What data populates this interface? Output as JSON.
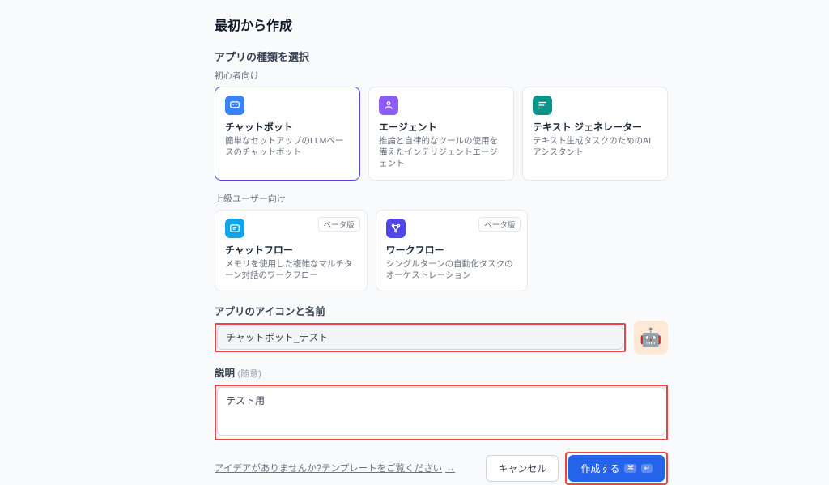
{
  "title": "最初から作成",
  "section_select_label": "アプリの種類を選択",
  "beginner_label": "初心者向け",
  "advanced_label": "上級ユーザー向け",
  "beta_label": "ベータ版",
  "cards": {
    "chatbot": {
      "title": "チャットボット",
      "desc": "簡単なセットアップのLLMベースのチャットボット"
    },
    "agent": {
      "title": "エージェント",
      "desc": "推論と自律的なツールの使用を備えたインテリジェントエージェント"
    },
    "textgen": {
      "title": "テキスト ジェネレーター",
      "desc": "テキスト生成タスクのためのAIアシスタント"
    },
    "chatflow": {
      "title": "チャットフロー",
      "desc": "メモリを使用した複雑なマルチターン対話のワークフロー"
    },
    "workflow": {
      "title": "ワークフロー",
      "desc": "シングルターンの自動化タスクのオーケストレーション"
    }
  },
  "name_field": {
    "label": "アプリのアイコンと名前",
    "value": "チャットボット_テスト"
  },
  "desc_field": {
    "label": "説明",
    "optional": "(随意)",
    "value": "テスト用"
  },
  "template_hint": "アイデアがありませんか?テンプレートをご覧ください",
  "arrow": "→",
  "buttons": {
    "cancel": "キャンセル",
    "create": "作成する"
  },
  "robot_emoji": "🤖"
}
